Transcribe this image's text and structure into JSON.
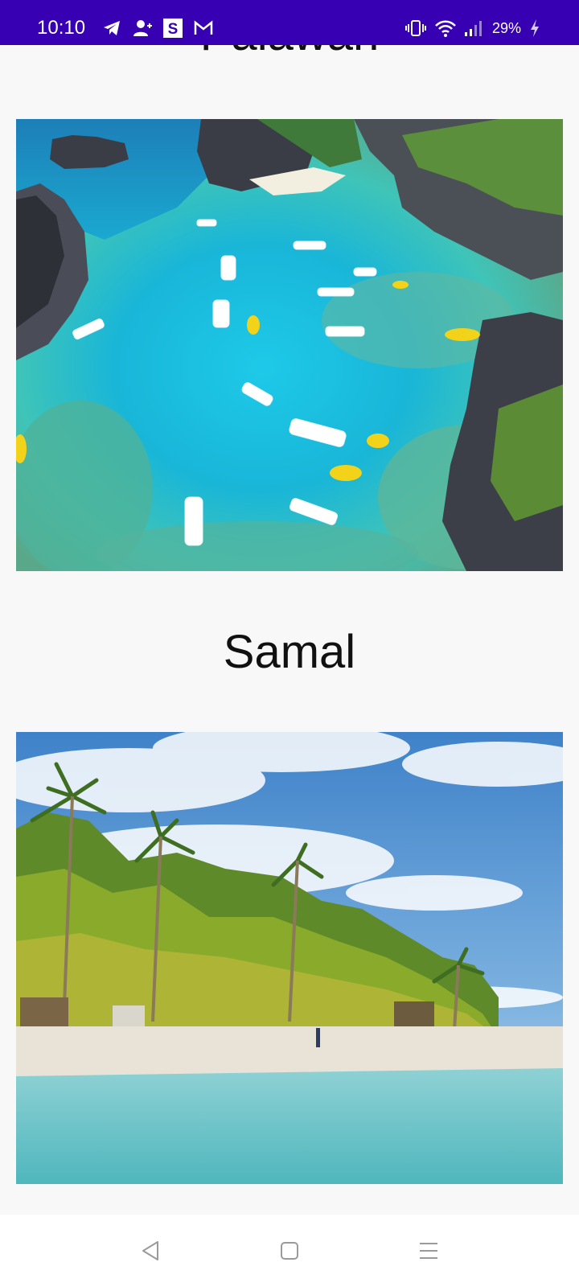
{
  "status_bar": {
    "time": "10:10",
    "battery": "29%",
    "left_icons": [
      "telegram-icon",
      "add-contact-icon",
      "s-app-icon",
      "gmail-icon"
    ],
    "right_icons": [
      "vibrate-icon",
      "wifi-icon",
      "signal-icon",
      "battery-charging-icon"
    ],
    "background": "#3700b3"
  },
  "places": [
    {
      "title": "Palawan",
      "image": "lagoon-photo"
    },
    {
      "title": "Samal",
      "image": "beach-photo"
    }
  ],
  "nav_bar": {
    "icons": [
      "back-icon",
      "home-icon",
      "recents-icon"
    ]
  }
}
